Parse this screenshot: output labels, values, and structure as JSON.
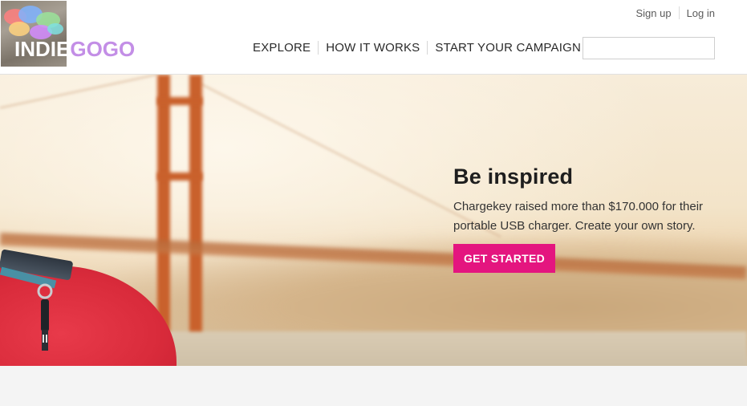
{
  "header": {
    "logo": {
      "text_part1": "INDIE",
      "text_part2": "GOGO",
      "accent_color": "#c38ee6"
    },
    "auth": {
      "signup_label": "Sign up",
      "login_label": "Log in"
    },
    "nav": {
      "items": [
        {
          "label": "EXPLORE"
        },
        {
          "label": "HOW IT WORKS"
        },
        {
          "label": "START YOUR CAMPAIGN"
        }
      ]
    },
    "search": {
      "icon": "search-icon",
      "placeholder": ""
    }
  },
  "hero": {
    "title": "Be inspired",
    "text": "Chargekey raised more than $170.000 for their portable USB charger. Create your own story.",
    "cta_label": "GET STARTED",
    "cta_color": "#e4157f"
  }
}
